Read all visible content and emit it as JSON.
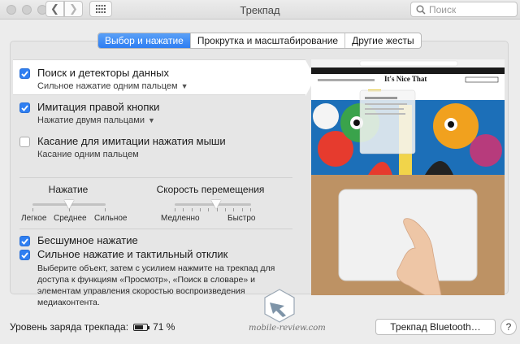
{
  "window": {
    "title": "Трекпад"
  },
  "search": {
    "placeholder": "Поиск"
  },
  "tabs": [
    {
      "label": "Выбор и нажатие",
      "active": true
    },
    {
      "label": "Прокрутка и масштабирование",
      "active": false
    },
    {
      "label": "Другие жесты",
      "active": false
    }
  ],
  "options": [
    {
      "title": "Поиск и детекторы данных",
      "subtitle": "Сильное нажатие одним пальцем",
      "checked": true,
      "has_menu": true
    },
    {
      "title": "Имитация правой кнопки",
      "subtitle": "Нажатие двумя пальцами",
      "checked": true,
      "has_menu": true
    },
    {
      "title": "Касание для имитации нажатия мыши",
      "subtitle": "Касание одним пальцем",
      "checked": false,
      "has_menu": false
    }
  ],
  "sliders": {
    "click": {
      "label": "Нажатие",
      "min_label": "Легкое",
      "mid_label": "Среднее",
      "max_label": "Сильное",
      "value_step": 1,
      "steps": 3
    },
    "speed": {
      "label": "Скорость перемещения",
      "min_label": "Медленно",
      "max_label": "Быстро",
      "value_fraction": 0.55,
      "steps": 10
    }
  },
  "bottom_options": [
    {
      "title": "Бесшумное нажатие",
      "checked": true
    },
    {
      "title": "Сильное нажатие и тактильный отклик",
      "checked": true
    }
  ],
  "description": "Выберите объект, затем с усилием нажмите на трекпад для доступа к функциям «Просмотр», «Поиск в словаре» и элементам управления скоростью воспроизведения медиаконтента.",
  "battery": {
    "label": "Уровень заряда трекпада:",
    "percent": "71 %",
    "level": 0.71
  },
  "buttons": {
    "bluetooth": "Трекпад Bluetooth…",
    "help": "?"
  },
  "preview": {
    "site_title": "It's Nice That"
  },
  "watermark": {
    "text": "mobile-review.com"
  },
  "colors": {
    "accent": "#2f7ff2"
  }
}
